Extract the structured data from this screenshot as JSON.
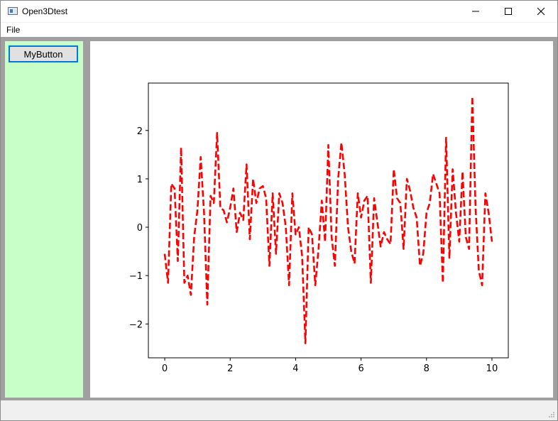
{
  "window": {
    "title": "Open3Dtest",
    "icon": "app-window-icon"
  },
  "titlebar_buttons": [
    "minimize-icon",
    "maximize-icon",
    "close-icon"
  ],
  "menu": {
    "file_label": "File"
  },
  "sidebar": {
    "button_label": "MyButton",
    "background": "#c8ffc8"
  },
  "chart_data": {
    "type": "line",
    "line_style": "dashed",
    "color": "#ff0000",
    "xlim": [
      -0.5,
      10.5
    ],
    "ylim": [
      -2.7,
      2.98
    ],
    "xticks": [
      0,
      2,
      4,
      6,
      8,
      10
    ],
    "yticks": [
      -2,
      -1,
      0,
      1,
      2
    ],
    "grid": false,
    "series": [
      {
        "x": [
          0.0,
          0.1,
          0.2,
          0.3,
          0.4,
          0.5,
          0.6,
          0.7,
          0.8,
          0.9,
          1.0,
          1.1,
          1.2,
          1.3,
          1.4,
          1.5,
          1.6,
          1.7,
          1.8,
          1.9,
          2.0,
          2.1,
          2.2,
          2.3,
          2.4,
          2.5,
          2.6,
          2.7,
          2.8,
          2.9,
          3.0,
          3.1,
          3.2,
          3.3,
          3.4,
          3.5,
          3.6,
          3.7,
          3.8,
          3.9,
          4.0,
          4.1,
          4.2,
          4.3,
          4.4,
          4.5,
          4.6,
          4.7,
          4.8,
          4.9,
          5.0,
          5.1,
          5.2,
          5.3,
          5.4,
          5.5,
          5.6,
          5.7,
          5.8,
          5.9,
          6.0,
          6.1,
          6.2,
          6.3,
          6.4,
          6.5,
          6.6,
          6.7,
          6.8,
          6.9,
          7.0,
          7.1,
          7.2,
          7.3,
          7.4,
          7.5,
          7.6,
          7.7,
          7.8,
          7.9,
          8.0,
          8.1,
          8.2,
          8.3,
          8.4,
          8.5,
          8.6,
          8.7,
          8.8,
          8.9,
          9.0,
          9.1,
          9.2,
          9.3,
          9.4,
          9.5,
          9.6,
          9.7,
          9.8,
          9.9,
          10.0
        ],
        "y": [
          -0.55,
          -1.15,
          0.9,
          0.8,
          -0.7,
          1.65,
          -1.15,
          -1.0,
          -1.4,
          -0.2,
          0.35,
          1.45,
          0.3,
          -1.6,
          0.65,
          0.5,
          1.95,
          0.4,
          0.35,
          0.1,
          0.4,
          0.8,
          -0.1,
          0.3,
          0.15,
          1.3,
          -0.25,
          1.0,
          0.5,
          0.8,
          0.85,
          0.6,
          -0.8,
          0.7,
          -0.55,
          0.7,
          0.5,
          0.0,
          -1.2,
          0.7,
          -0.15,
          0.0,
          -0.6,
          -2.4,
          0.0,
          -0.15,
          -1.2,
          -0.45,
          0.55,
          -0.3,
          1.7,
          -0.2,
          -0.8,
          1.0,
          1.75,
          1.1,
          0.0,
          -0.5,
          -0.75,
          0.7,
          0.2,
          0.55,
          0.65,
          -1.15,
          0.6,
          0.1,
          -0.4,
          -0.1,
          -0.25,
          -0.35,
          1.2,
          0.6,
          0.5,
          -0.45,
          1.0,
          0.75,
          0.4,
          0.2,
          -0.8,
          -0.55,
          0.3,
          0.5,
          1.1,
          0.9,
          0.7,
          -1.15,
          1.85,
          -0.65,
          1.2,
          0.3,
          -0.3,
          1.15,
          -0.2,
          -0.45,
          2.7,
          0.4,
          -0.9,
          -1.2,
          0.7,
          0.3,
          -0.3
        ]
      }
    ]
  }
}
